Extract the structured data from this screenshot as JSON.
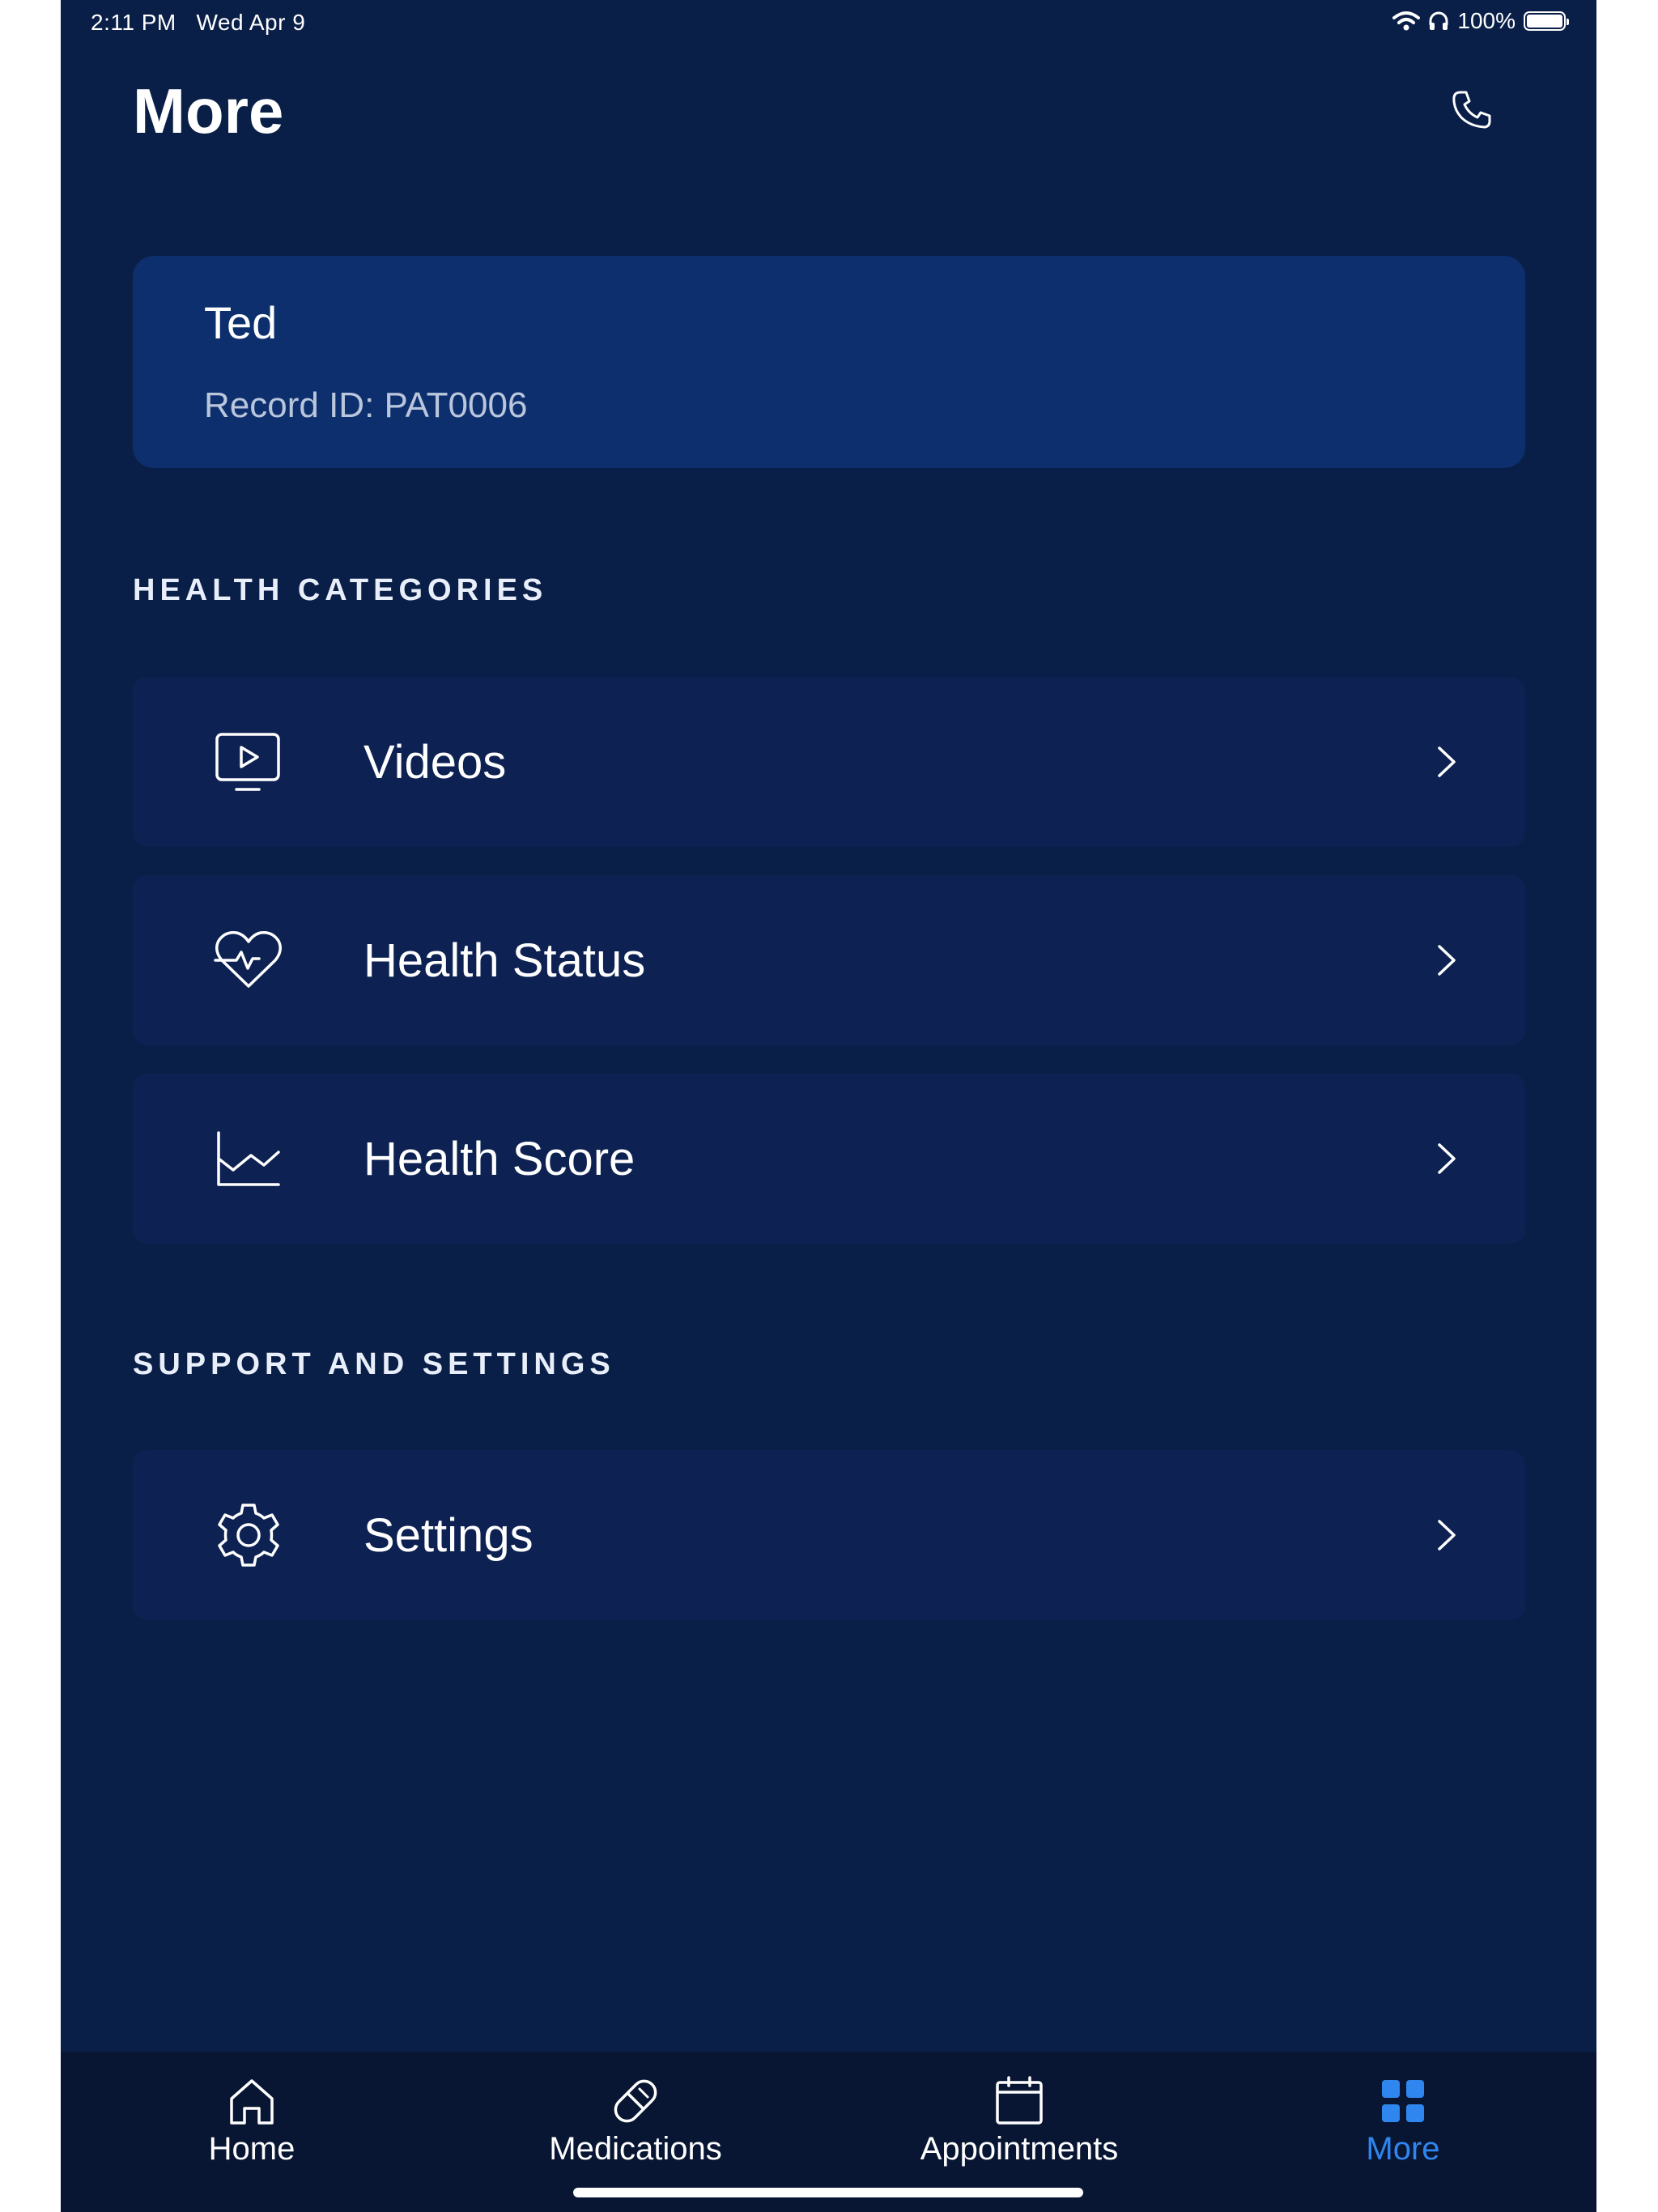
{
  "status_bar": {
    "time": "2:11 PM",
    "date": "Wed Apr 9",
    "battery": "100%"
  },
  "header": {
    "title": "More"
  },
  "profile": {
    "name": "Ted",
    "record": "Record ID: PAT0006"
  },
  "sections": {
    "health_categories": {
      "heading": "HEALTH CATEGORIES",
      "items": [
        {
          "label": "Videos",
          "icon": "video-icon"
        },
        {
          "label": "Health Status",
          "icon": "heart-pulse-icon"
        },
        {
          "label": "Health Score",
          "icon": "line-chart-icon"
        }
      ]
    },
    "support": {
      "heading": "SUPPORT AND SETTINGS",
      "items": [
        {
          "label": "Settings",
          "icon": "gear-icon"
        }
      ]
    }
  },
  "tab_bar": {
    "tabs": [
      {
        "label": "Home",
        "icon": "home-icon"
      },
      {
        "label": "Medications",
        "icon": "pill-icon"
      },
      {
        "label": "Appointments",
        "icon": "calendar-icon"
      },
      {
        "label": "More",
        "icon": "grid-icon",
        "active": true
      }
    ]
  },
  "colors": {
    "background": "#0a1f47",
    "card": "#0d2f6e",
    "row": "#0d2252",
    "tab_bar": "#081633",
    "accent": "#2f86ee"
  }
}
